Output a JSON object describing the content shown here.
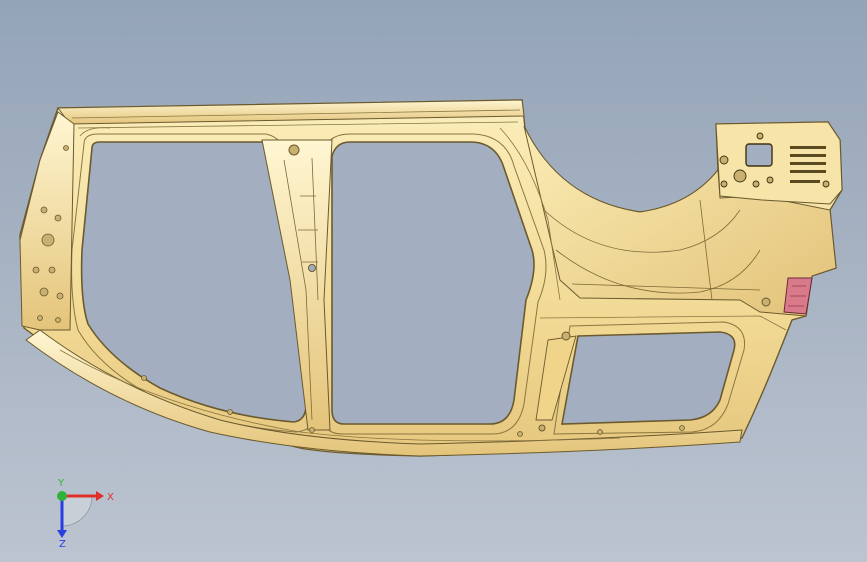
{
  "viewport": {
    "background_top": "#94a4b8",
    "background_bottom": "#bcc4d0"
  },
  "part": {
    "name": "",
    "color_fill": "#f4e2a2",
    "color_shade": "#d9bd72",
    "color_edge": "#6b5a2e",
    "accent_color": "#d97a8a"
  },
  "triad": {
    "x_label": "X",
    "y_label": "Y",
    "z_label": "Z",
    "x_color": "#e0302a",
    "y_color": "#2fb23a",
    "z_color": "#2a3ee0"
  }
}
